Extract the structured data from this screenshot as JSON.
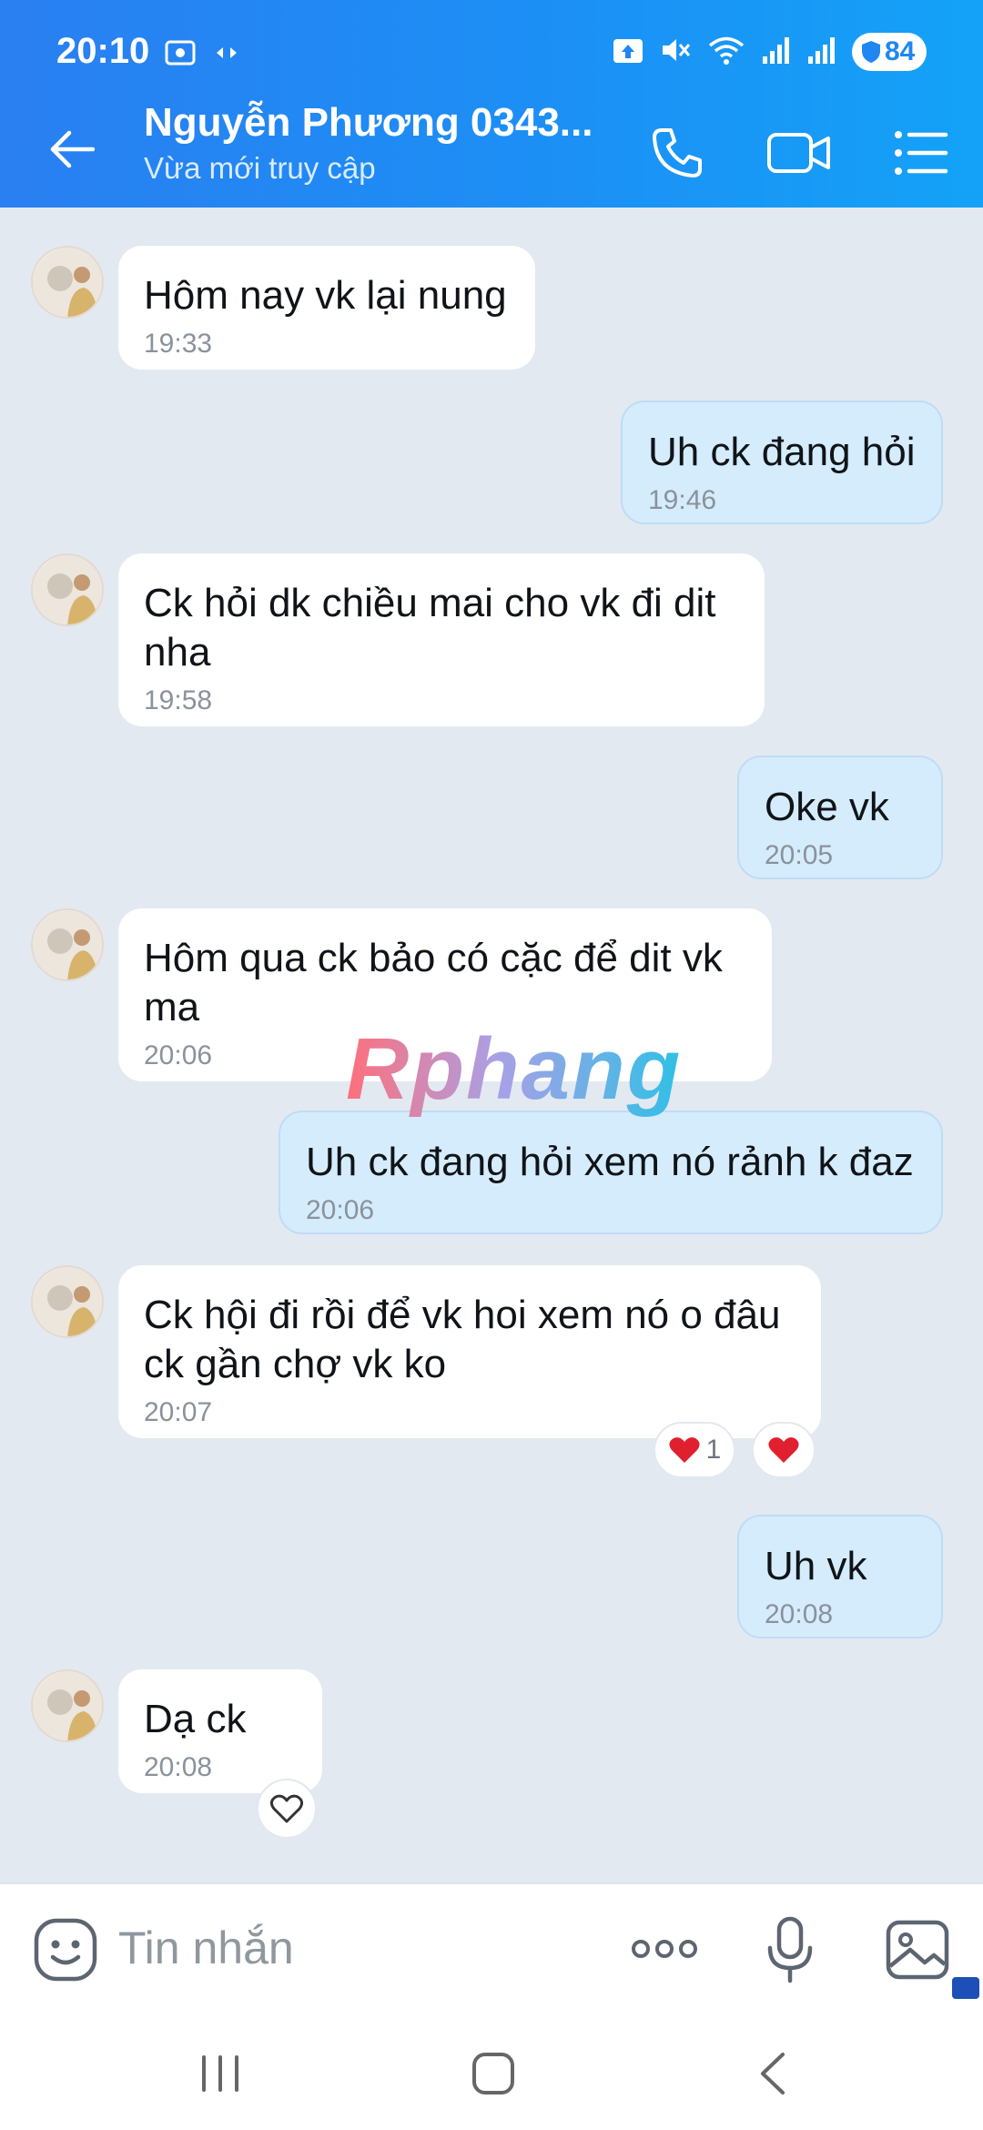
{
  "status_bar": {
    "time": "20:10",
    "battery": "84"
  },
  "header": {
    "contact_name": "Nguyễn Phương 0343...",
    "contact_status": "Vừa mới truy cập"
  },
  "messages": [
    {
      "direction": "in",
      "text": "Hôm nay vk lại nung",
      "time": "19:33"
    },
    {
      "direction": "out",
      "text": "Uh ck đang hỏi",
      "time": "19:46"
    },
    {
      "direction": "in",
      "text": "Ck hỏi dk chiều mai cho vk đi dit\nnha",
      "time": "19:58"
    },
    {
      "direction": "out",
      "text": "Oke vk",
      "time": "20:05"
    },
    {
      "direction": "in",
      "text": "Hôm qua ck bảo có cặc để dit vk\nma",
      "time": "20:06"
    },
    {
      "direction": "out",
      "text": "Uh ck đang hỏi xem nó rảnh k đaz",
      "time": "20:06"
    },
    {
      "direction": "in",
      "text": "Ck hội đi rồi để vk hoi xem nó o đâu\nck gần chợ vk ko",
      "time": "20:07"
    },
    {
      "direction": "out",
      "text": "Uh vk",
      "time": "20:08"
    },
    {
      "direction": "in",
      "text": "Dạ ck",
      "time": "20:08"
    }
  ],
  "reactions": {
    "count_label": "1"
  },
  "watermark": "Rphang",
  "composer": {
    "placeholder": "Tin nhắn"
  },
  "colors": {
    "header_start": "#2a7ff1",
    "header_end": "#14a2f8",
    "outgoing_bubble": "#d5ecfd",
    "incoming_bubble": "#ffffff",
    "background": "#e3e9f1",
    "heart": "#e0202f"
  },
  "icons": {
    "back": "arrow-left-icon",
    "call": "phone-icon",
    "video": "video-camera-icon",
    "menu": "list-menu-icon",
    "emoji": "sticker-face-icon",
    "more": "more-dots-icon",
    "mic": "microphone-icon",
    "gallery": "image-gallery-icon"
  }
}
